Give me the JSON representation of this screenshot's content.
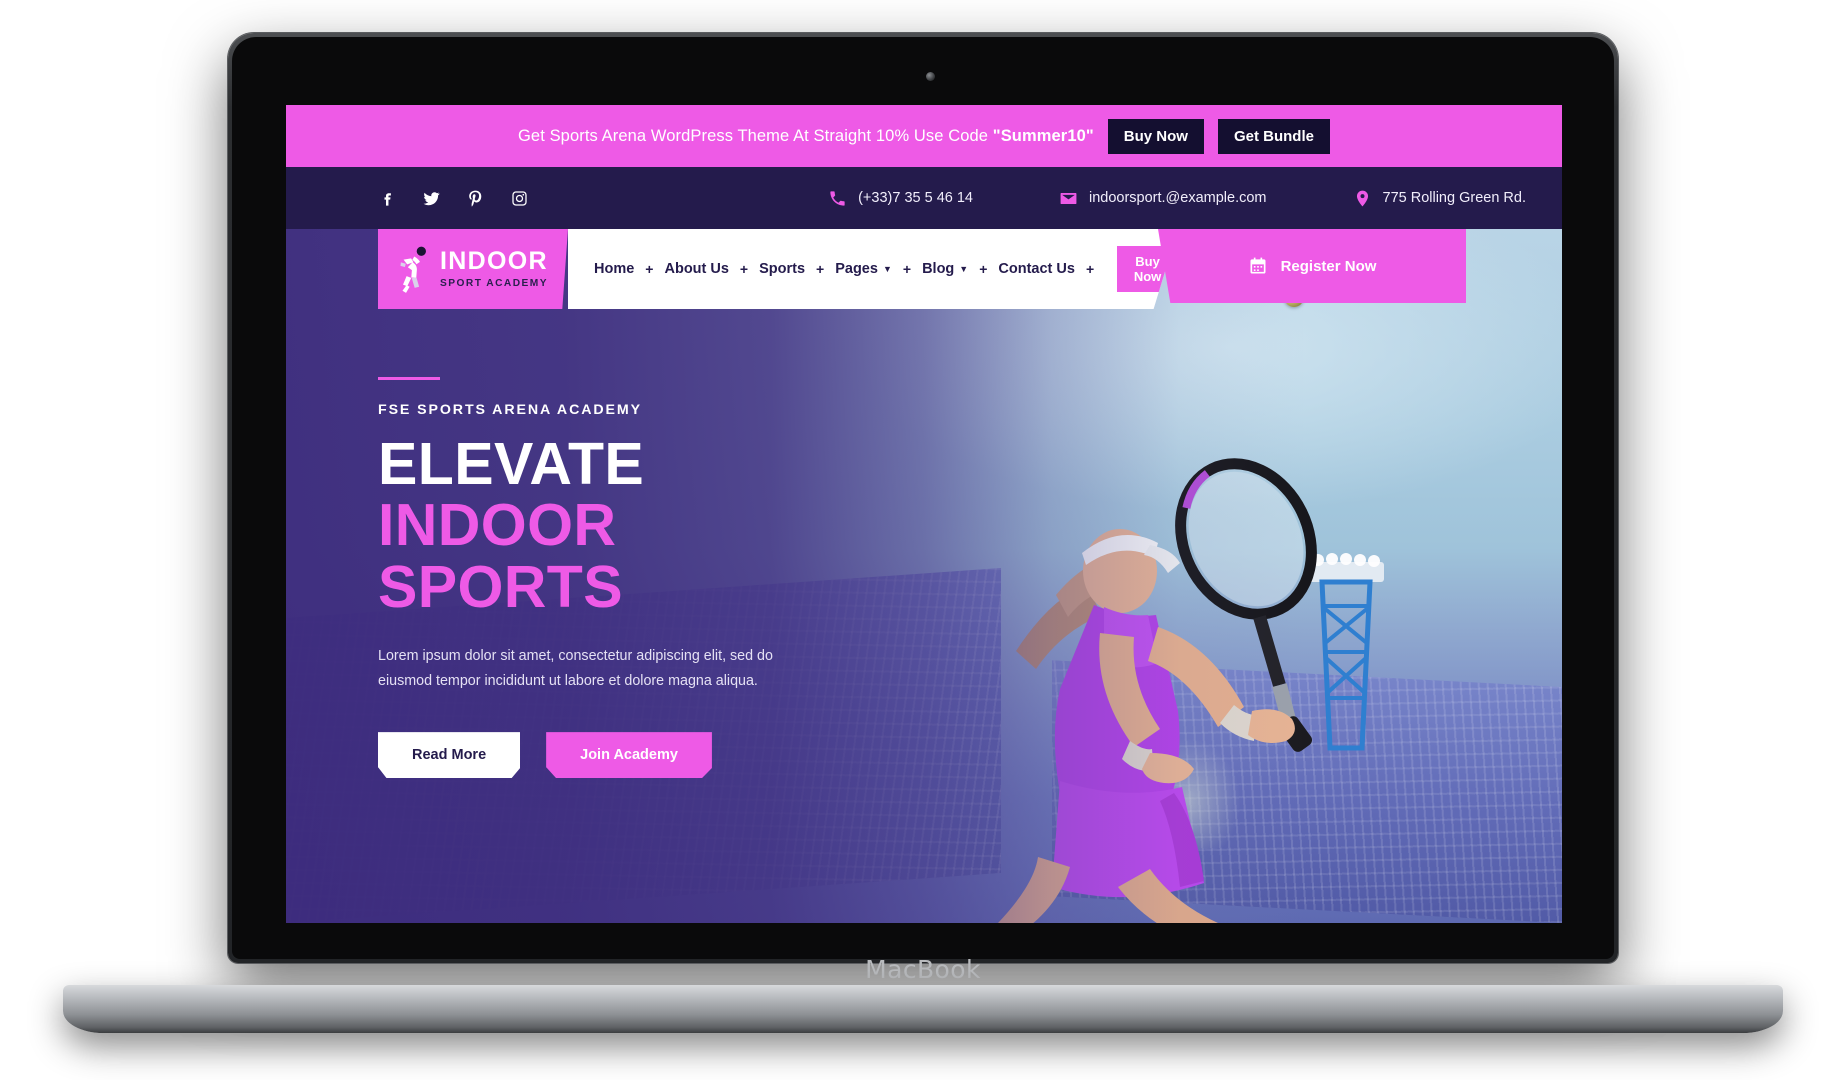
{
  "device": {
    "brand": "MacBook"
  },
  "promo": {
    "text_before": "Get Sports Arena WordPress Theme At Straight 10% Use Code ",
    "code": "\"Summer10\"",
    "buy_now_label": "Buy Now",
    "get_bundle_label": "Get Bundle",
    "bar_color": "#ee5ae6",
    "button_color": "#140f30"
  },
  "topbar": {
    "background": "#241b4c",
    "socials": [
      {
        "name": "facebook-icon",
        "label": "Facebook"
      },
      {
        "name": "twitter-icon",
        "label": "Twitter"
      },
      {
        "name": "pinterest-icon",
        "label": "Pinterest"
      },
      {
        "name": "instagram-icon",
        "label": "Instagram"
      }
    ],
    "phone": "(+33)7 35 5 46 14",
    "email": "indoorsport.@example.com",
    "address": "775 Rolling Green Rd."
  },
  "logo": {
    "title": "INDOOR",
    "subtitle": "SPORT ACADEMY",
    "mark": "volleyball-player-icon",
    "background": "#ee5ae6"
  },
  "nav": {
    "separator": "+",
    "items": [
      {
        "label": "Home",
        "has_dropdown": false
      },
      {
        "label": "About Us",
        "has_dropdown": false
      },
      {
        "label": "Sports",
        "has_dropdown": false
      },
      {
        "label": "Pages",
        "has_dropdown": true
      },
      {
        "label": "Blog",
        "has_dropdown": true
      },
      {
        "label": "Contact Us",
        "has_dropdown": false
      }
    ],
    "buy_now_label": "Buy Now",
    "register_label": "Register Now",
    "register_icon": "calendar-icon"
  },
  "hero": {
    "eyebrow": "FSE SPORTS ARENA ACADEMY",
    "line1": "ELEVATE",
    "line2": "INDOOR",
    "line3": "SPORTS",
    "paragraph": "Lorem ipsum dolor sit amet, consectetur adipiscing elit, sed do eiusmod tempor incididunt ut labore et dolore magna aliqua.",
    "read_more_label": "Read More",
    "join_academy_label": "Join Academy",
    "accent_color": "#ee5ae6",
    "heading_white": "#ffffff",
    "overlay_color": "#3c2a7c",
    "image_alt": "female-tennis-player-hitting-forehand-in-stadium"
  }
}
